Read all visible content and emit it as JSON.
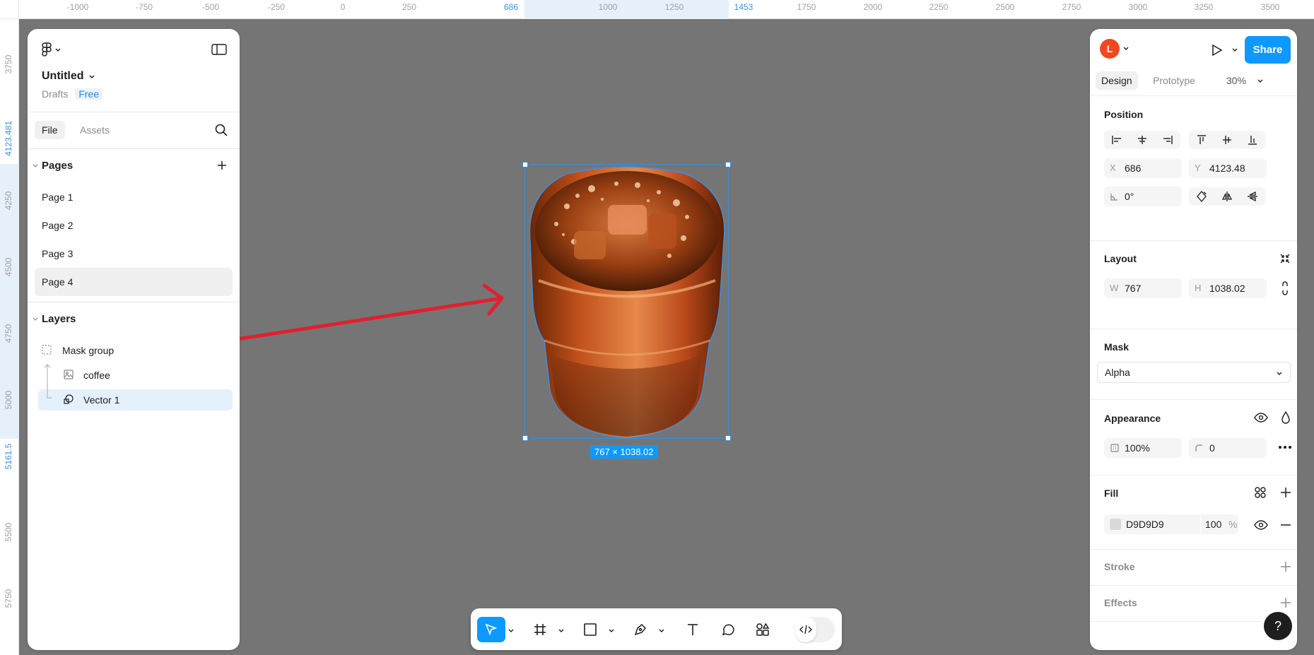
{
  "ruler_top": {
    "ticks": [
      "-1000",
      "-750",
      "-500",
      "-250",
      "0",
      "250",
      "1000",
      "1250",
      "1750",
      "2000",
      "2250",
      "2500",
      "2750",
      "3000",
      "3250",
      "3500"
    ],
    "sel_start": "686",
    "sel_end": "1453"
  },
  "ruler_left": {
    "ticks": [
      "3750",
      "4250",
      "4500",
      "4750",
      "5000",
      "5500",
      "5750"
    ],
    "sel_start": "4123.481",
    "sel_end": "5161.5"
  },
  "left_panel": {
    "file_name": "Untitled",
    "location": "Drafts",
    "plan": "Free",
    "tabs": {
      "file": "File",
      "assets": "Assets"
    },
    "pages_title": "Pages",
    "pages": [
      "Page 1",
      "Page 2",
      "Page 3",
      "Page 4"
    ],
    "active_page": "Page 4",
    "layers_title": "Layers",
    "layers": [
      "Mask group",
      "coffee",
      "Vector 1"
    ]
  },
  "right_panel": {
    "avatar_letter": "L",
    "share_label": "Share",
    "tabs": {
      "design": "Design",
      "prototype": "Prototype"
    },
    "zoom": "30%",
    "position": {
      "title": "Position",
      "x_label": "X",
      "x": "686",
      "y_label": "Y",
      "y": "4123.48",
      "rotation": "0°"
    },
    "layout": {
      "title": "Layout",
      "w_label": "W",
      "w": "767",
      "h_label": "H",
      "h": "1038.02"
    },
    "mask": {
      "title": "Mask",
      "value": "Alpha"
    },
    "appearance": {
      "title": "Appearance",
      "opacity": "100%",
      "radius": "0"
    },
    "fill": {
      "title": "Fill",
      "hex": "D9D9D9",
      "opacity": "100",
      "unit": "%",
      "swatch_color": "#D9D9D9"
    },
    "stroke": {
      "title": "Stroke"
    },
    "effects": {
      "title": "Effects"
    }
  },
  "canvas": {
    "dimensions_label": "767 × 1038.02",
    "background_color": "#757575"
  },
  "toolbar": {
    "tools": [
      "move-tool",
      "frame-tool",
      "shape-tool",
      "pen-tool",
      "text-tool",
      "comment-tool",
      "actions-tool",
      "dev-mode-toggle"
    ]
  },
  "help_label": "?"
}
